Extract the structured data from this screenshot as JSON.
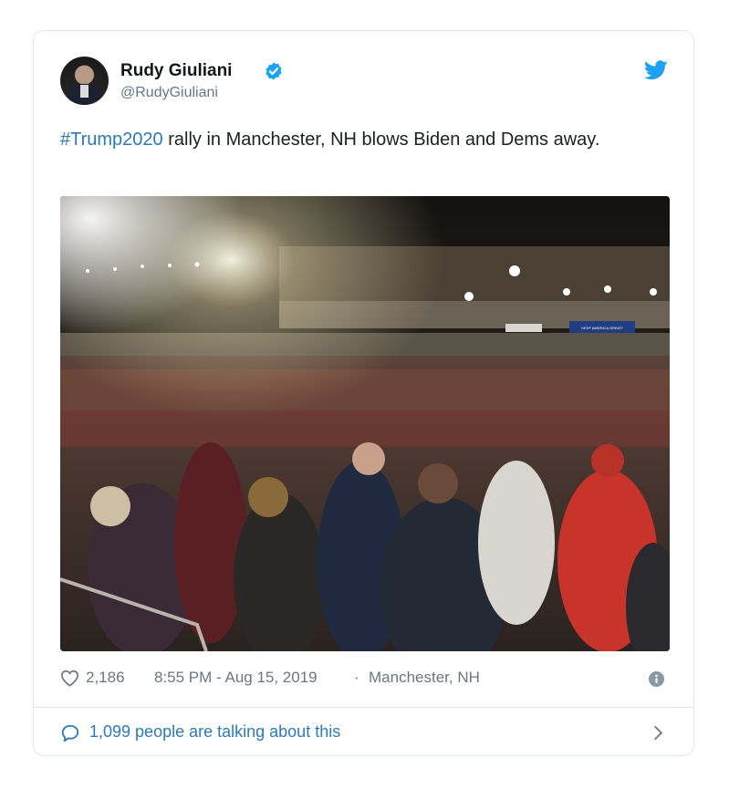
{
  "tweet": {
    "author_name": "Rudy Giuliani",
    "handle": "@RudyGiuliani",
    "hashtag": "#Trump2020",
    "text": " rally in Manchester, NH blows Biden and Dems away.",
    "likes": "2,186",
    "time": "8:55 PM - Aug 15, 2019",
    "separator": "·",
    "location": "Manchester, NH",
    "talking": "1,099 people are talking about this",
    "photo_banner": "KEEP AMERICA GREAT!"
  },
  "colors": {
    "link": "#2b7bb9",
    "verified": "#1da1f2",
    "muted": "#697882",
    "border": "#e1e8ed"
  },
  "icons": {
    "verified": "verified-badge-icon",
    "bird": "twitter-bird-icon",
    "heart": "heart-icon",
    "info": "info-icon",
    "bubble": "speech-bubble-icon",
    "chevron": "chevron-right-icon"
  }
}
